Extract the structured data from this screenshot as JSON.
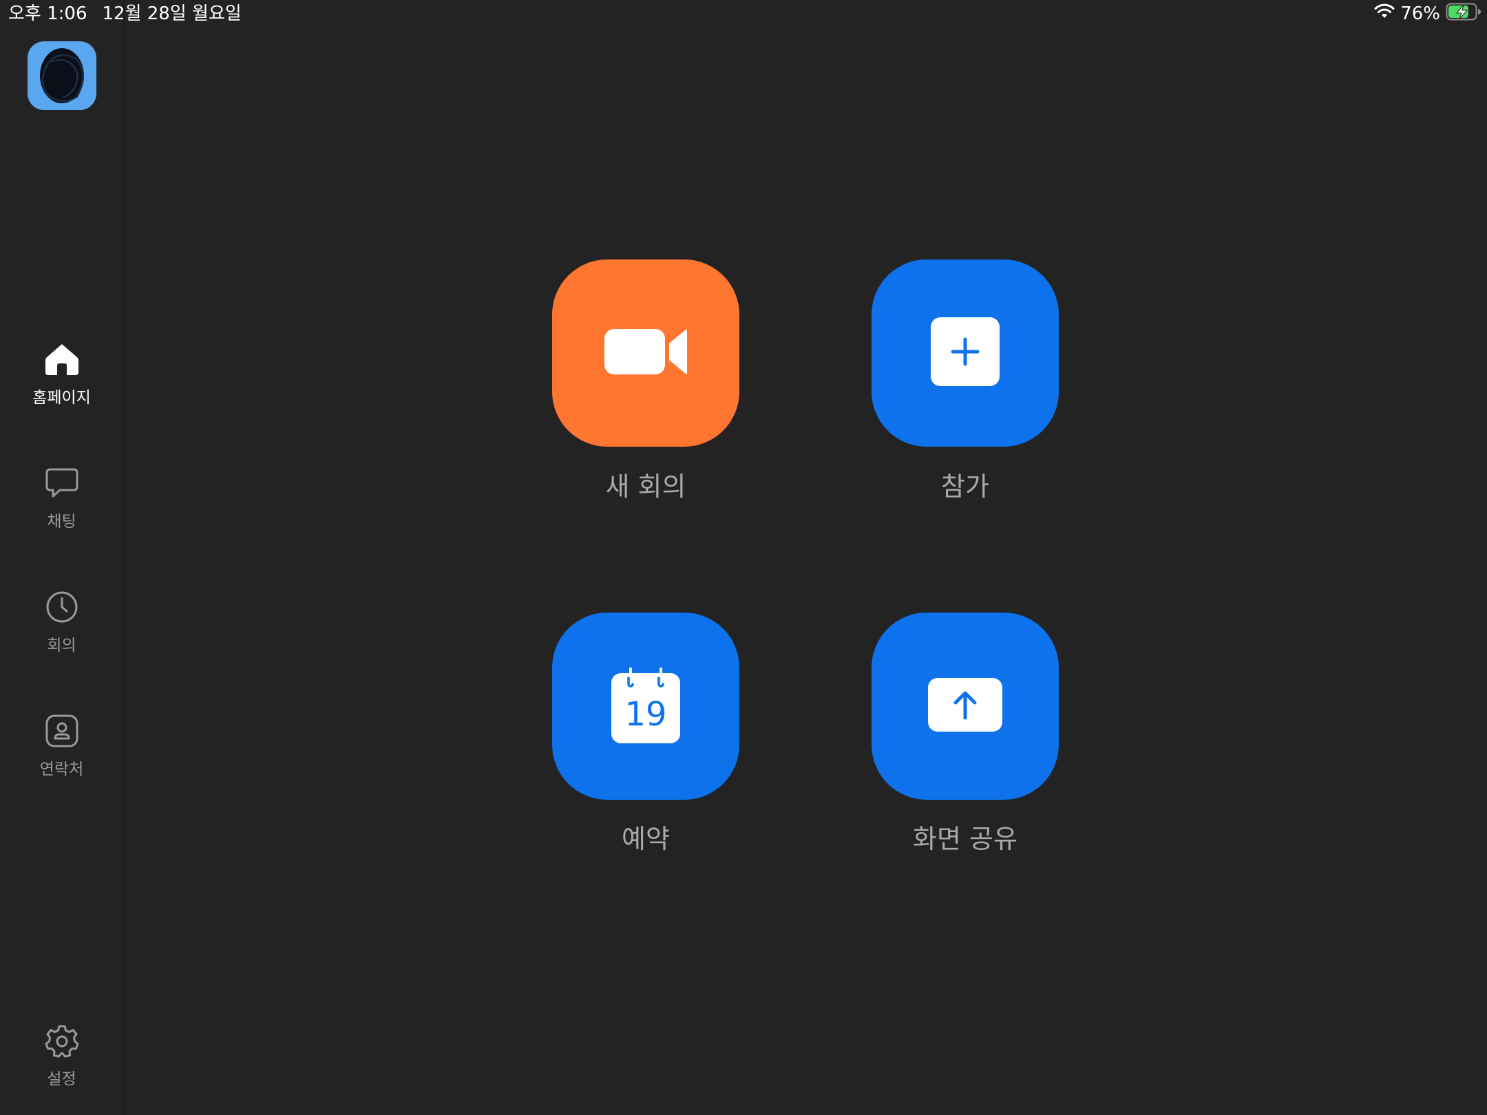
{
  "status_bar": {
    "time": "오후 1:06",
    "date": "12월 28일 월요일",
    "battery_percent": "76%",
    "battery_level": 0.76,
    "wifi_icon": "wifi-icon",
    "battery_icon": "battery-charging-icon"
  },
  "sidebar": {
    "avatar_icon": "avatar",
    "items": [
      {
        "label": "홈페이지",
        "icon": "home-icon",
        "active": true
      },
      {
        "label": "채팅",
        "icon": "chat-bubble-icon",
        "active": false
      },
      {
        "label": "회의",
        "icon": "clock-icon",
        "active": false
      },
      {
        "label": "연락처",
        "icon": "contact-icon",
        "active": false
      }
    ],
    "settings": {
      "label": "설정",
      "icon": "gear-icon"
    }
  },
  "actions": [
    {
      "label": "새 회의",
      "icon": "video-camera-icon",
      "color": "#ff7630"
    },
    {
      "label": "참가",
      "icon": "plus-icon",
      "color": "#0e72ed"
    },
    {
      "label": "예약",
      "icon": "calendar-icon",
      "calendar_day": "19",
      "color": "#0e72ed"
    },
    {
      "label": "화면 공유",
      "icon": "share-screen-icon",
      "color": "#0e72ed"
    }
  ],
  "colors": {
    "background": "#232323",
    "accent_blue": "#0e72ed",
    "accent_orange": "#ff7630",
    "label_gray": "#a9a9a9",
    "battery_green": "#4cd964"
  }
}
